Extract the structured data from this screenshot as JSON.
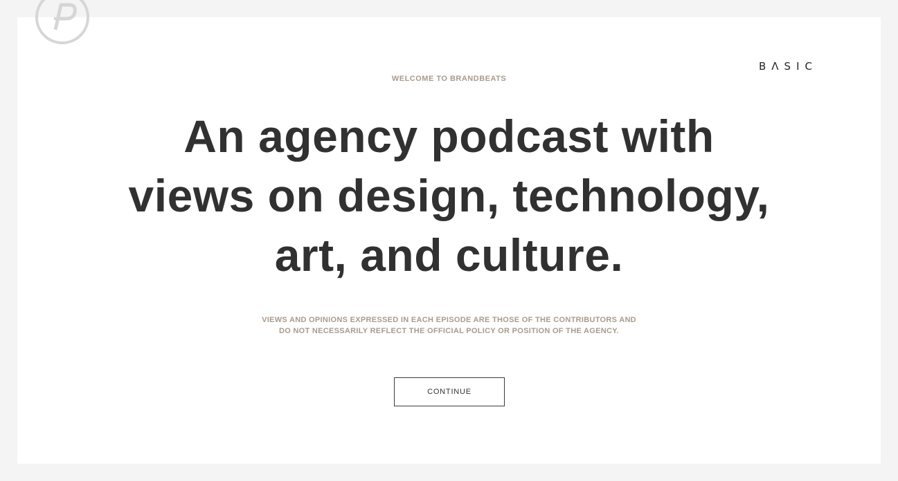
{
  "brand": {
    "wordmark": "BΛSIC",
    "logo_icon": "brandbeats-circle-logo-icon"
  },
  "hero": {
    "eyebrow": "WELCOME TO BRANDBEATS",
    "headline_lines": [
      "An agency podcast with",
      "views on design, technology,",
      "art, and culture."
    ],
    "disclaimer_lines": [
      "VIEWS AND OPINIONS EXPRESSED IN EACH EPISODE ARE THOSE OF THE CONTRIBUTORS AND",
      "DO NOT NECESSARILY REFLECT THE OFFICIAL POLICY OR POSITION OF THE AGENCY."
    ],
    "continue_label": "CONTINUE"
  },
  "colors": {
    "page_background": "#f4f4f4",
    "card_background": "#ffffff",
    "headline_text": "#313131",
    "accent_muted_text": "#a89a8c",
    "logo_gray": "#d6d6d6"
  }
}
